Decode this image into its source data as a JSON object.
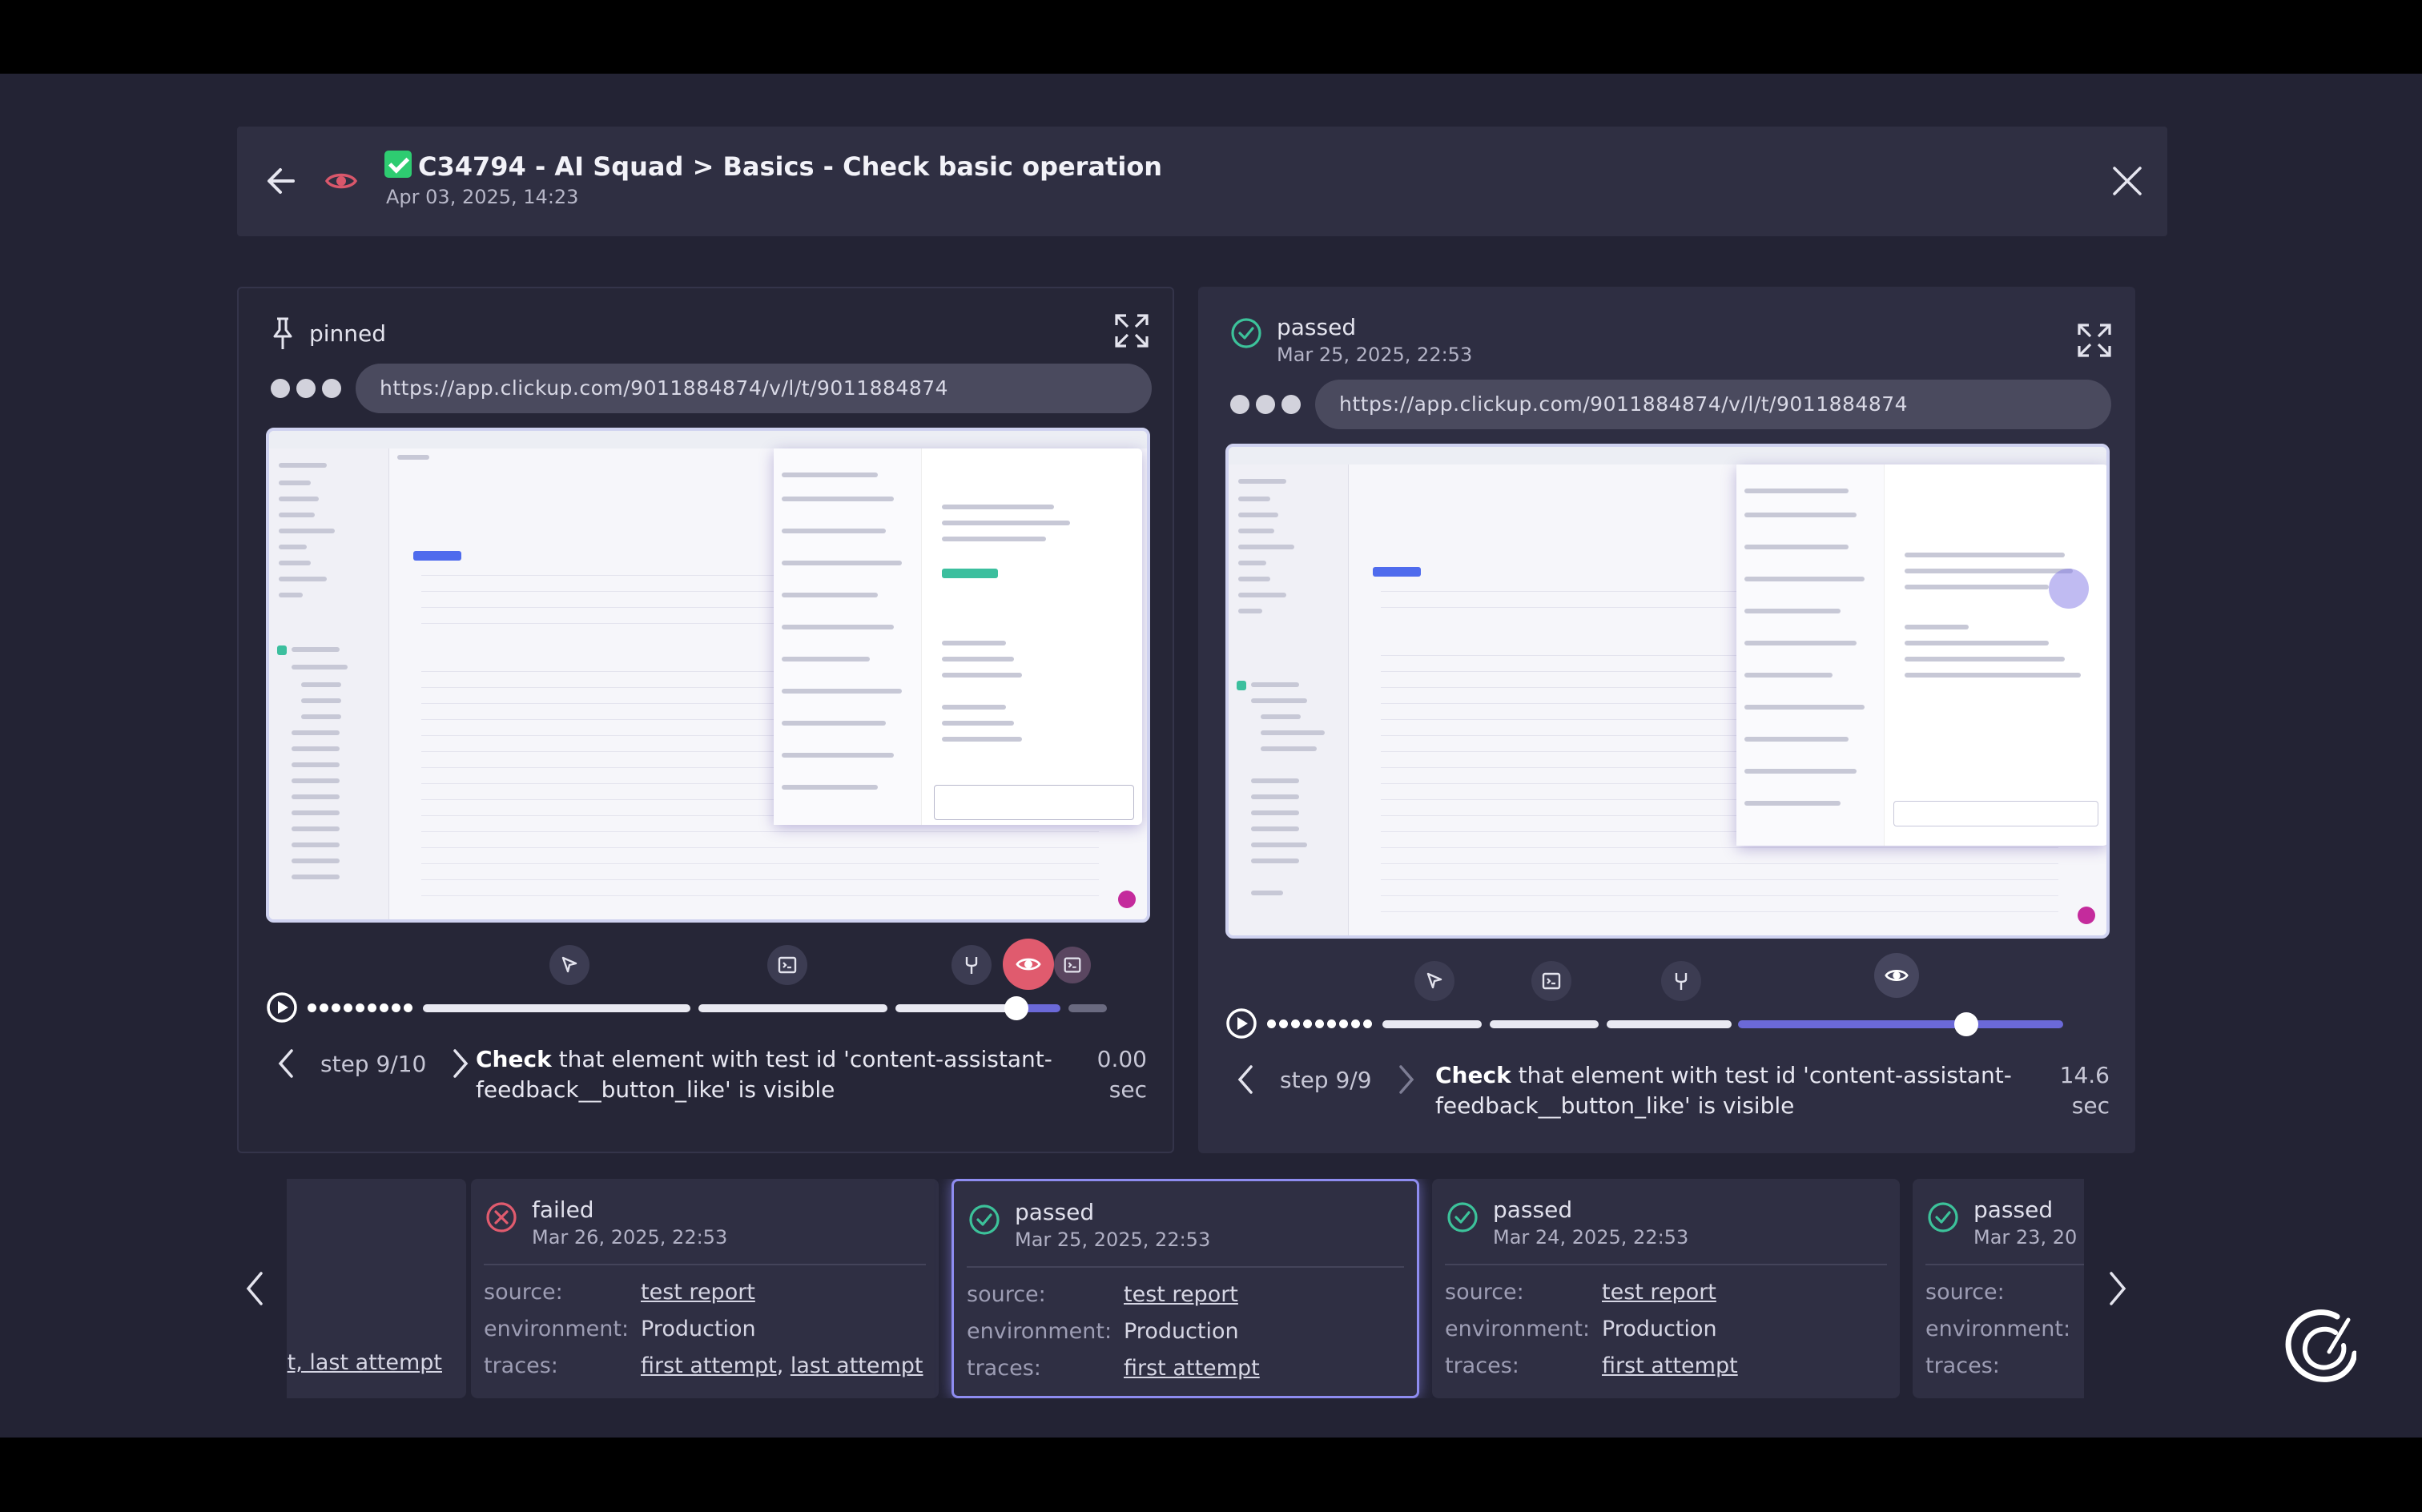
{
  "header": {
    "title": "C34794 - AI Squad > Basics - Check basic operation",
    "date": "Apr 03, 2025, 14:23"
  },
  "left_panel": {
    "status": "pinned",
    "url": "https://app.clickup.com/9011884874/v/l/t/9011884874",
    "step_label": "step 9/10",
    "step_verb": "Check",
    "step_text": " that element with test id 'content-assistant-feedback__button_like' is visible",
    "time_value": "0.00",
    "time_unit": "sec",
    "progress": 0.86
  },
  "right_panel": {
    "status": "passed",
    "date": "Mar 25, 2025, 22:53",
    "url": "https://app.clickup.com/9011884874/v/l/t/9011884874",
    "step_label": "step 9/9",
    "step_verb": "Check",
    "step_text": " that element with test id 'content-assistant-feedback__button_like' is visible",
    "time_value": "14.6",
    "time_unit": "sec",
    "progress": 0.87
  },
  "runs": [
    {
      "status": "",
      "date": "",
      "traces_tail": "t, last attempt"
    },
    {
      "status": "failed",
      "date": "Mar 26, 2025, 22:53",
      "source_label": "source:",
      "source": "test report",
      "env_label": "environment:",
      "environment": "Production",
      "traces_label": "traces:",
      "trace1": "first attempt",
      "trace2": "last attempt"
    },
    {
      "status": "passed",
      "date": "Mar 25, 2025, 22:53",
      "source_label": "source:",
      "source": "test report",
      "env_label": "environment:",
      "environment": "Production",
      "traces_label": "traces:",
      "trace1": "first attempt"
    },
    {
      "status": "passed",
      "date": "Mar 24, 2025, 22:53",
      "source_label": "source:",
      "source": "test report",
      "env_label": "environment:",
      "environment": "Production",
      "traces_label": "traces:",
      "trace1": "first attempt"
    },
    {
      "status": "passed",
      "date": "Mar 23, 20",
      "source_label": "source:",
      "env_label": "environment:",
      "traces_label": "traces:"
    }
  ],
  "colors": {
    "background": "#232334",
    "accent": "#8e8cf0",
    "passed": "#3cc29a",
    "failed": "#e05b6e"
  },
  "icons": [
    "back-arrow-icon",
    "eye-icon",
    "close-icon",
    "pin-icon",
    "expand-icon",
    "check-circle-icon",
    "x-circle-icon",
    "cursor-icon",
    "terminal-icon",
    "fork-icon",
    "play-icon",
    "chevron-left-icon",
    "chevron-right-icon",
    "logo-icon"
  ]
}
